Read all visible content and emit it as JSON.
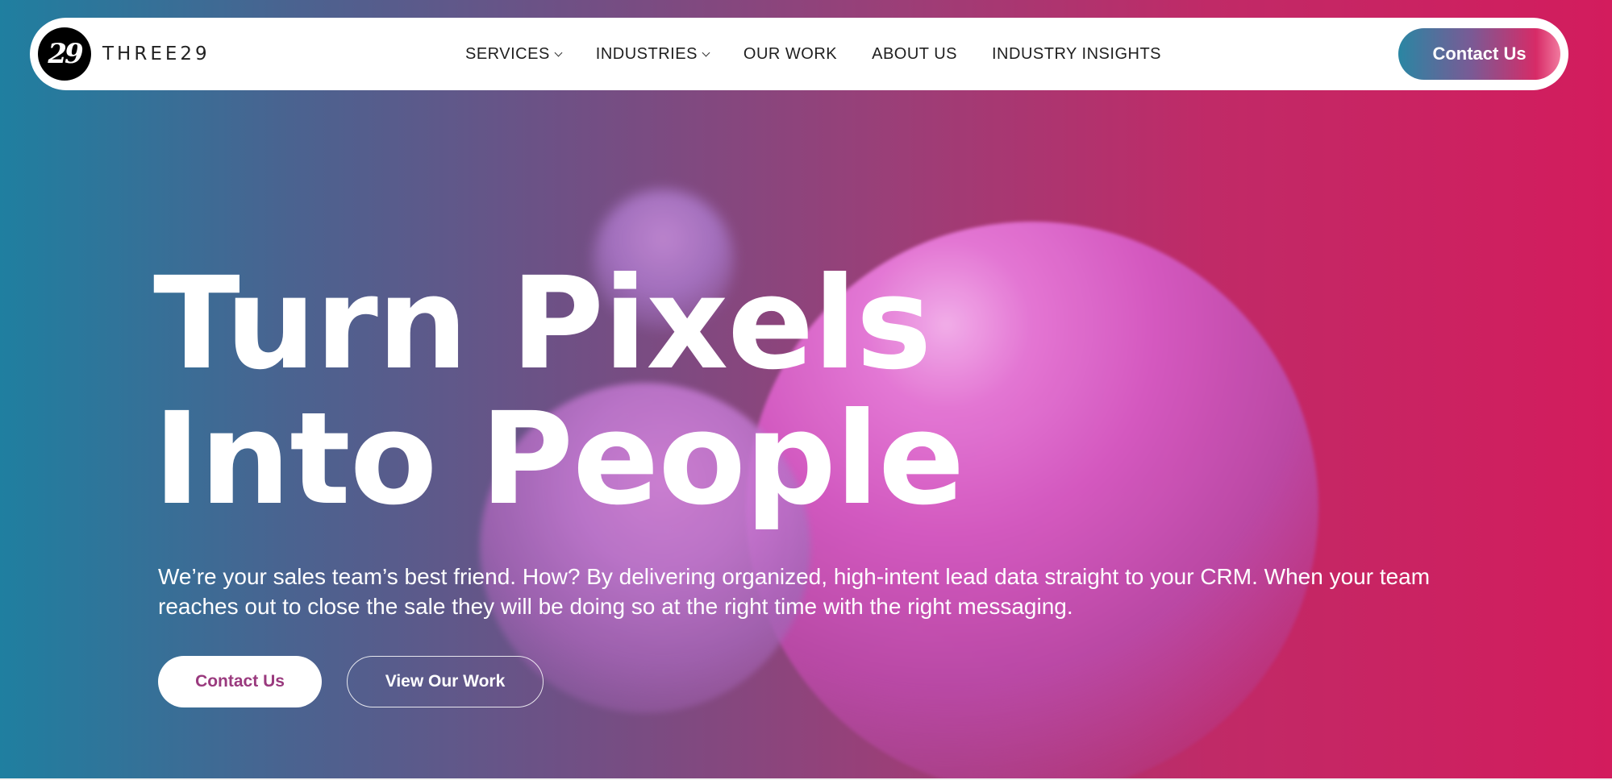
{
  "brand": {
    "logo_mark": "29",
    "name": "THREE29"
  },
  "nav": {
    "items": [
      {
        "label": "SERVICES",
        "has_dropdown": true
      },
      {
        "label": "INDUSTRIES",
        "has_dropdown": true
      },
      {
        "label": "OUR WORK",
        "has_dropdown": false
      },
      {
        "label": "ABOUT US",
        "has_dropdown": false
      },
      {
        "label": "INDUSTRY INSIGHTS",
        "has_dropdown": false
      }
    ],
    "contact_label": "Contact Us"
  },
  "hero": {
    "headline_line1": "Turn Pixels",
    "headline_line2": "Into People",
    "subtext": "We’re your sales team’s best friend. How? By delivering organized, high-intent lead data straight to your CRM. When your team reaches out to close the sale they will be doing so at the right time with the right messaging.",
    "primary_button": "Contact Us",
    "secondary_button": "View Our Work"
  },
  "colors": {
    "gradient_start": "#1f7fa0",
    "gradient_mid": "#9a3f78",
    "gradient_end": "#d31c5d",
    "primary_button_text": "#9a3a7e"
  },
  "icons": {
    "dropdown": "chevron-down-icon"
  }
}
